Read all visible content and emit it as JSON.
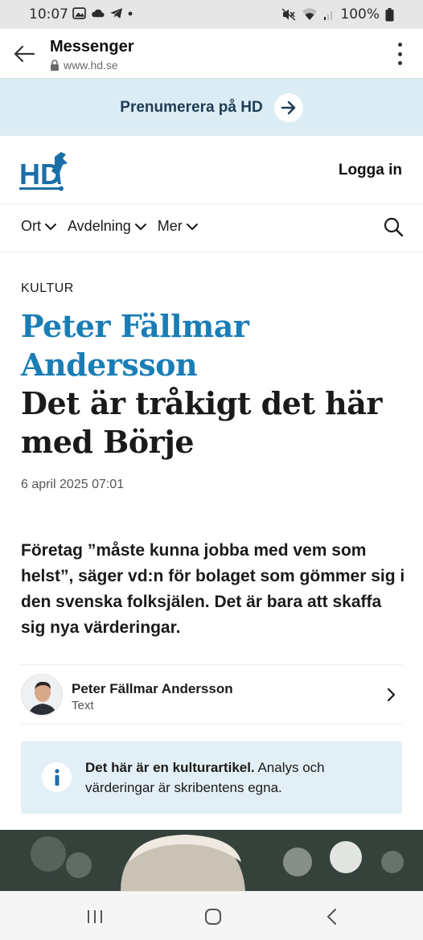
{
  "status_bar": {
    "time": "10:07",
    "battery": "100%",
    "icons": [
      "gallery-icon",
      "cloud-icon",
      "telegram-icon",
      "dot-icon",
      "mute-icon",
      "wifi-icon",
      "signal-icon",
      "battery-icon"
    ]
  },
  "browser": {
    "title": "Messenger",
    "url": "www.hd.se",
    "back_icon": "arrow-left-icon",
    "menu_icon": "more-vertical-icon"
  },
  "subscribe": {
    "label": "Prenumerera på HD",
    "icon": "arrow-right-icon"
  },
  "header": {
    "logo_text": "HD",
    "login_label": "Logga in"
  },
  "nav": {
    "items": [
      {
        "label": "Ort"
      },
      {
        "label": "Avdelning"
      },
      {
        "label": "Mer"
      }
    ],
    "search_icon": "search-icon"
  },
  "article": {
    "section": "KULTUR",
    "headline_author": "Peter Fällmar Andersson",
    "headline_title": "Det är tråkigt det här med Börje",
    "date": "6 april 2025 07:01",
    "lead": "Företag ”måste kunna jobba med vem som helst”, säger vd:n för bolaget som gömmer sig i den svenska folksjälen. Det är bara att skaffa sig nya värderingar.",
    "byline": {
      "name": "Peter Fällmar Andersson",
      "role": "Text"
    },
    "info_box": {
      "bold": "Det här är en kulturartikel.",
      "text": " Analys och värderingar är skribentens egna."
    }
  },
  "colors": {
    "accent_blue": "#1a7db6",
    "banner_bg": "#dcecf4",
    "info_bg": "#e2eff6",
    "banner_text": "#1d3c55"
  }
}
